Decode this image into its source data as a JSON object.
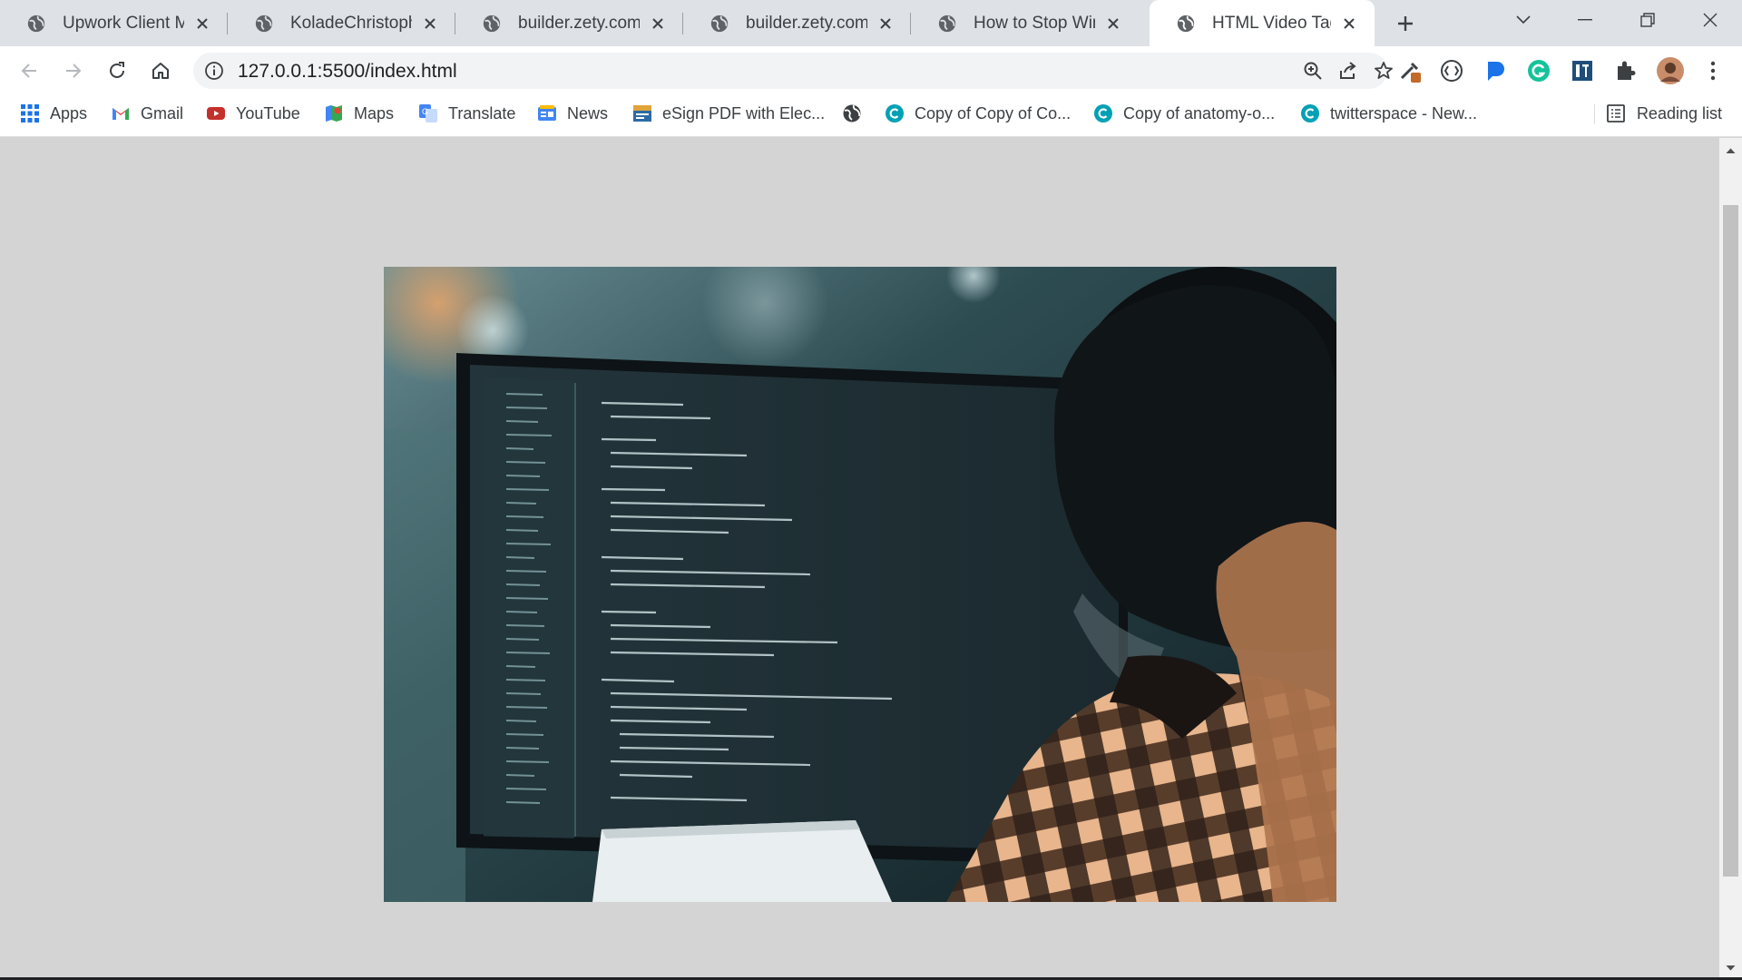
{
  "browser": {
    "tabs": [
      {
        "title": "Upwork Client Mag",
        "active": false
      },
      {
        "title": "KoladeChristopher",
        "active": false
      },
      {
        "title": "builder.zety.com",
        "active": false
      },
      {
        "title": "builder.zety.com",
        "active": false
      },
      {
        "title": "How to Stop Windo",
        "active": false
      },
      {
        "title": "HTML Video Tag",
        "active": true
      }
    ],
    "address": {
      "url": "127.0.0.1:5500/index.html"
    }
  },
  "bookmarks": {
    "items": [
      {
        "label": "Apps",
        "icon": "apps-grid-icon"
      },
      {
        "label": "Gmail",
        "icon": "gmail-icon"
      },
      {
        "label": "YouTube",
        "icon": "youtube-icon"
      },
      {
        "label": "Maps",
        "icon": "maps-icon"
      },
      {
        "label": "Translate",
        "icon": "translate-icon"
      },
      {
        "label": "News",
        "icon": "news-icon"
      },
      {
        "label": "eSign PDF with Elec...",
        "icon": "esign-icon"
      },
      {
        "label": "",
        "icon": "globe-icon"
      },
      {
        "label": "Copy of Copy of Co...",
        "icon": "canva-icon"
      },
      {
        "label": "Copy of anatomy-o...",
        "icon": "canva-icon"
      },
      {
        "label": "twitterspace - New...",
        "icon": "canva-icon"
      }
    ],
    "reading_list": "Reading list"
  },
  "colors": {
    "tabstrip": "#dee1e6",
    "page_background": "#d4d4d4",
    "canva_blue": "#00a1b5",
    "youtube_red": "#c4302b"
  }
}
